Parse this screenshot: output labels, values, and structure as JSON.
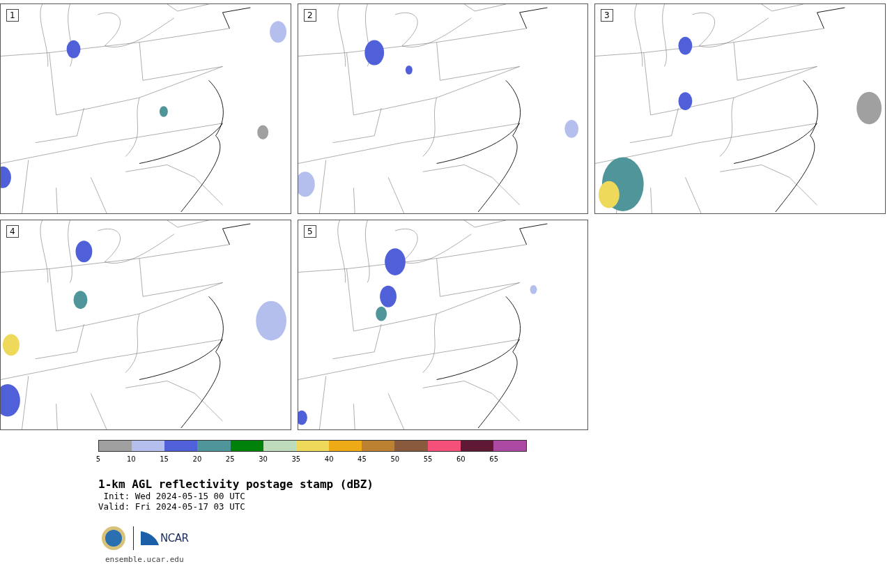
{
  "panels": [
    {
      "label": "1"
    },
    {
      "label": "2"
    },
    {
      "label": "3"
    },
    {
      "label": "4"
    },
    {
      "label": "5"
    }
  ],
  "colorbar": {
    "segments": [
      {
        "color": "#a0a0a0"
      },
      {
        "color": "#b4bfee"
      },
      {
        "color": "#5060d8"
      },
      {
        "color": "#4f9599"
      },
      {
        "color": "#00820a"
      },
      {
        "color": "#bedcbc"
      },
      {
        "color": "#eed95a"
      },
      {
        "color": "#efaa18"
      },
      {
        "color": "#bc8131"
      },
      {
        "color": "#8a5a3d"
      },
      {
        "color": "#f4507a"
      },
      {
        "color": "#5f1935"
      },
      {
        "color": "#ac4aa3"
      }
    ],
    "ticks": [
      "5",
      "10",
      "15",
      "20",
      "25",
      "30",
      "35",
      "40",
      "45",
      "50",
      "55",
      "60",
      "65"
    ]
  },
  "title": "1-km AGL reflectivity postage stamp (dBZ)",
  "init": " Init: Wed 2024-05-15 00 UTC",
  "valid": "Valid: Fri 2024-05-17 03 UTC",
  "logo": {
    "text": "NCAR"
  },
  "url": "ensemble.ucar.edu"
}
